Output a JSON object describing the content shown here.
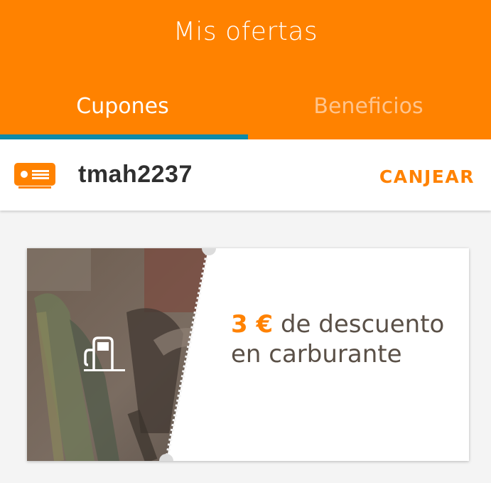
{
  "header": {
    "title": "Mis ofertas",
    "tabs": [
      {
        "label": "Cupones",
        "active": true
      },
      {
        "label": "Beneficios",
        "active": false
      }
    ]
  },
  "code_bar": {
    "icon": "coupon-card-icon",
    "code": "tmah2237",
    "action_label": "CANJEAR"
  },
  "coupon": {
    "icon": "fuel-pump-icon",
    "amount": "3 €",
    "description": "de descuento en carburante"
  },
  "colors": {
    "brand": "#ff8200",
    "tab_indicator": "#0e8aa8",
    "inactive_tab": "#ffc48c"
  }
}
